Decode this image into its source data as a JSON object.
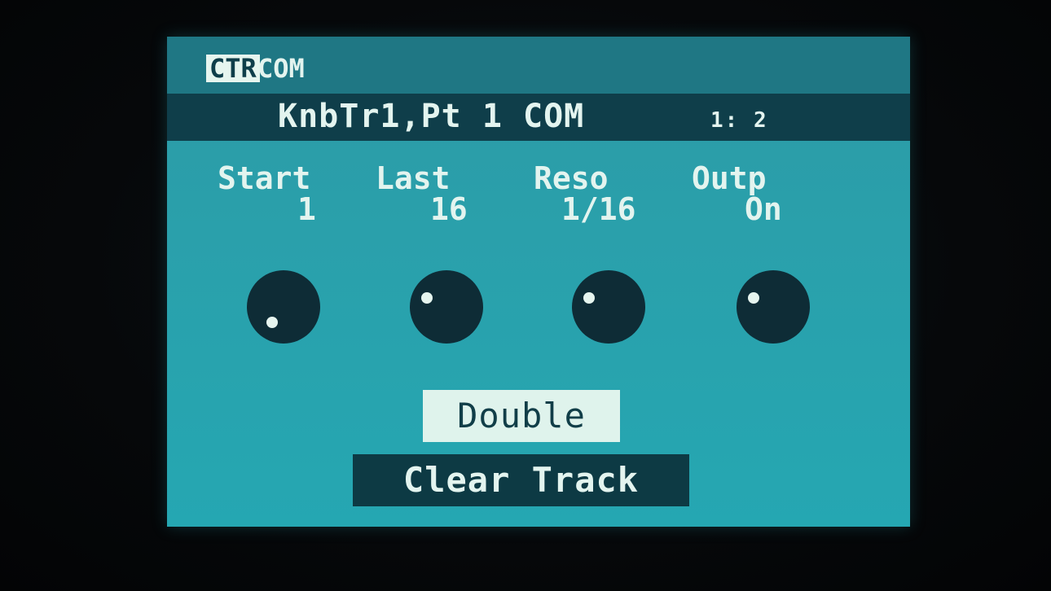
{
  "tabs": {
    "active": "CTR",
    "second": "COM"
  },
  "title": "KnbTr1,Pt 1 COM",
  "page_indicator": "1: 2",
  "params": [
    {
      "label": "Start",
      "value": "1"
    },
    {
      "label": "Last",
      "value": "16"
    },
    {
      "label": "Reso",
      "value": "1/16"
    },
    {
      "label": "Outp",
      "value": "On"
    }
  ],
  "buttons": {
    "double": "Double",
    "clear_track": "Clear Track"
  },
  "colors": {
    "screen": "#2aa0ab",
    "title_bar": "#0f3e4a",
    "text": "#e3f4ef",
    "knob": "#0e2c36"
  }
}
